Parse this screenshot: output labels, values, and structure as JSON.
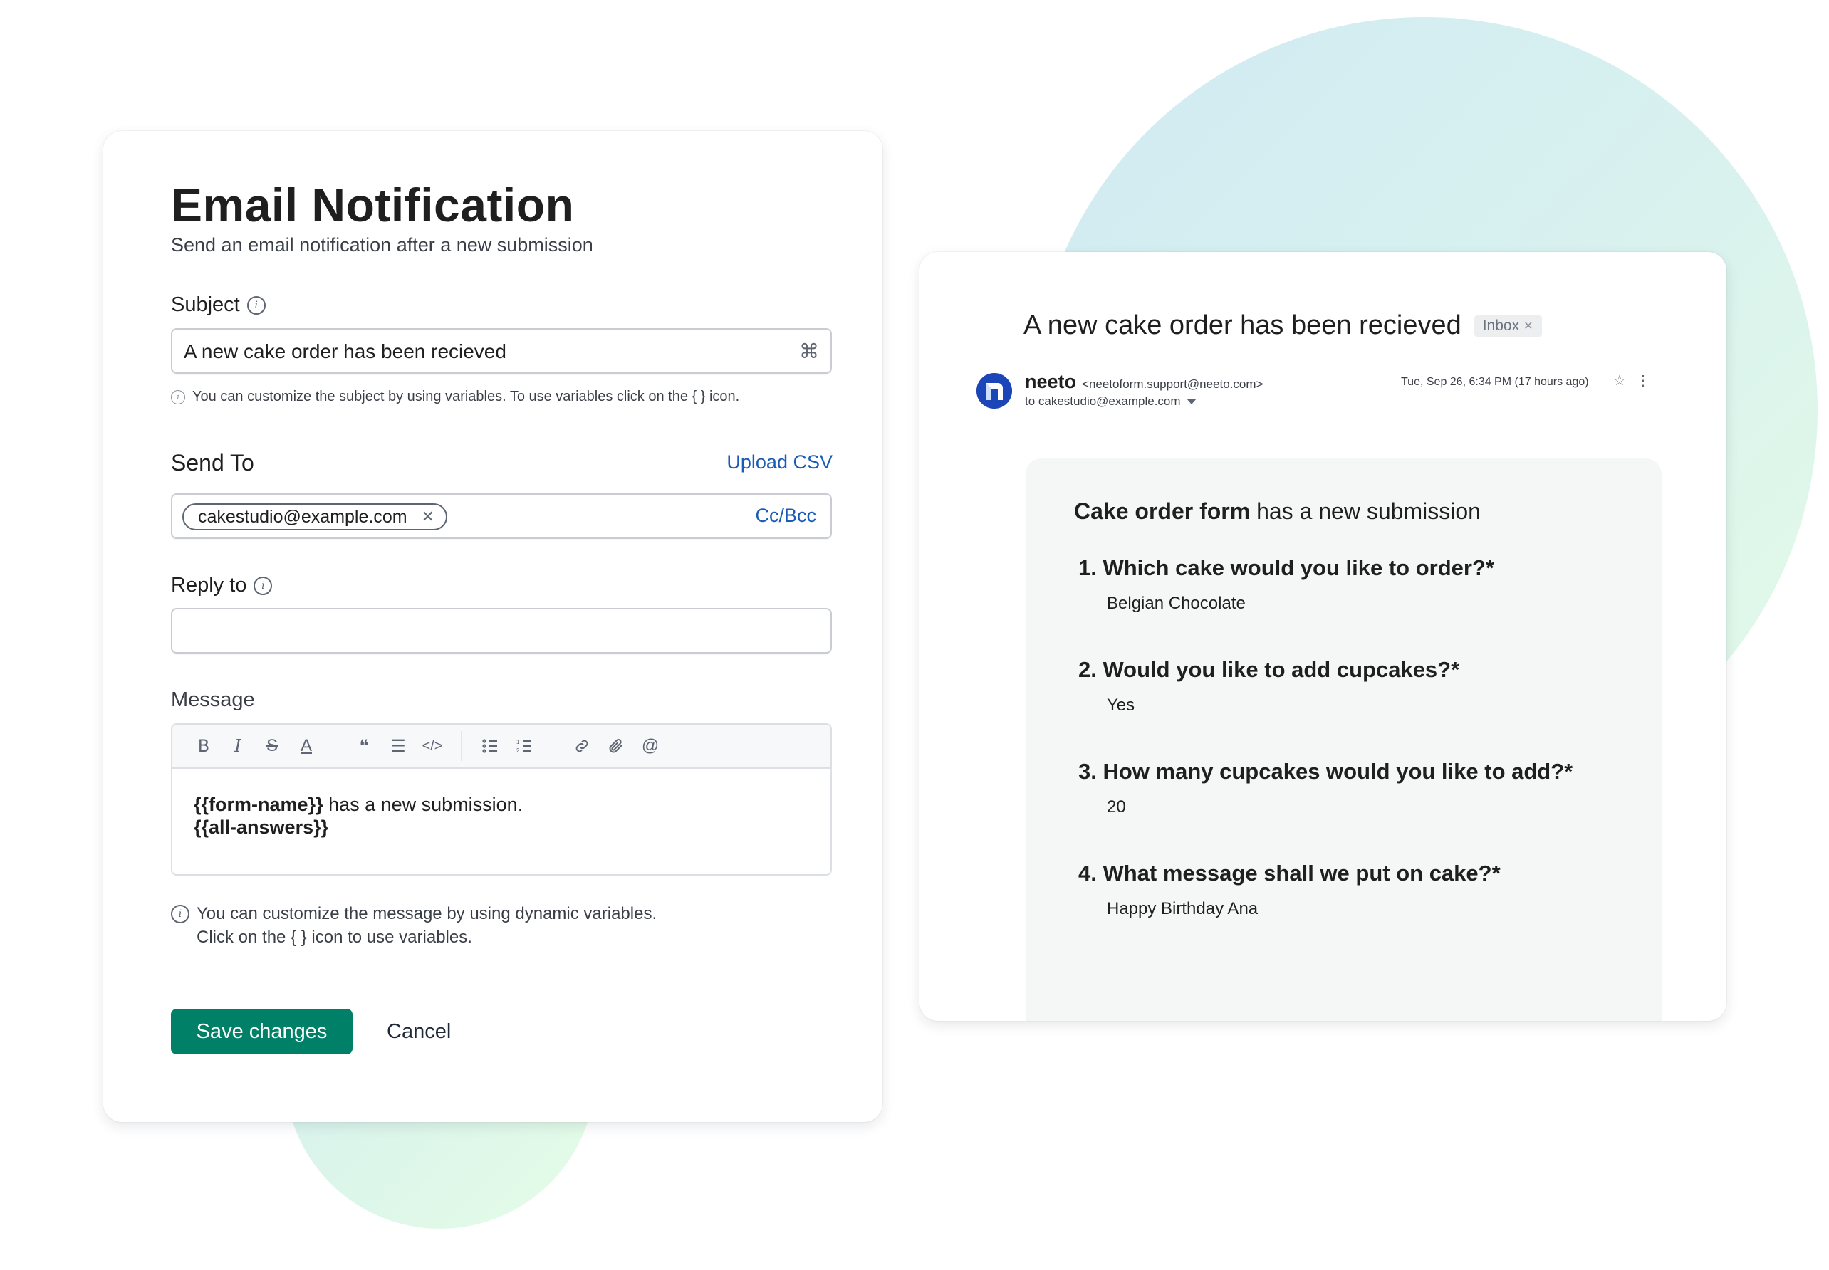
{
  "settings": {
    "title": "Email Notification",
    "subtitle": "Send an email notification after a new submission",
    "subject": {
      "label": "Subject",
      "value": "A new cake order has been recieved",
      "variables_icon": "command-icon",
      "helper": "You can customize the subject by using variables.  To use variables click on the { } icon."
    },
    "send_to": {
      "label": "Send To",
      "upload_csv": "Upload CSV",
      "chips": [
        "cakestudio@example.com"
      ],
      "cc_bcc": "Cc/Bcc"
    },
    "reply_to": {
      "label": "Reply to",
      "value": ""
    },
    "message": {
      "label": "Message",
      "toolbar": [
        "bold",
        "italic",
        "strikethrough",
        "text-color",
        "quote",
        "align",
        "code",
        "bullet-list",
        "numbered-list",
        "link",
        "attachment",
        "mention"
      ],
      "line1_var": "{{form-name}}",
      "line1_rest": " has a new submission.",
      "line2_var": "{{all-answers}}",
      "helper_line1": "You can customize the message by using dynamic variables.",
      "helper_line2": "Click on the { } icon to use variables."
    },
    "save_label": "Save changes",
    "cancel_label": "Cancel"
  },
  "preview": {
    "subject": "A new cake order has been recieved",
    "tag": "Inbox",
    "sender_name": "neeto",
    "sender_email": "<neetoform.support@neeto.com>",
    "to": "to cakestudio@example.com",
    "date": "Tue, Sep 26, 6:34 PM (17 hours ago)",
    "heading_bold": "Cake order form",
    "heading_rest": " has a new submission",
    "questions": [
      {
        "num": "1.",
        "q": "Which cake would you like to order?*",
        "a": "Belgian Chocolate"
      },
      {
        "num": "2.",
        "q": "Would you like to add cupcakes?*",
        "a": "Yes"
      },
      {
        "num": "3.",
        "q": "How many cupcakes would you like to add?*",
        "a": "20"
      },
      {
        "num": "4.",
        "q": "What message shall we put on cake?*",
        "a": "Happy Birthday Ana"
      }
    ]
  },
  "colors": {
    "primary": "#008066",
    "link": "#1a5bb5",
    "avatar": "#1c46b8"
  }
}
